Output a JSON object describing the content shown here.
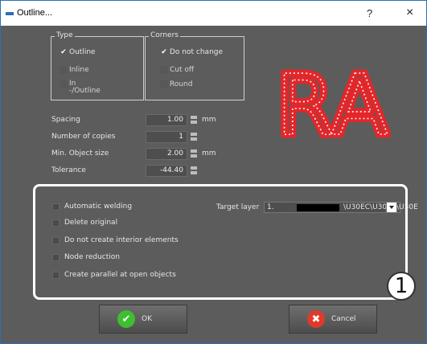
{
  "window": {
    "title": "Outline...",
    "help": "?",
    "close": "×"
  },
  "type_group": {
    "legend": "Type",
    "options": [
      {
        "label": "Outline",
        "checked": true
      },
      {
        "label": "Inline",
        "checked": false
      },
      {
        "label_line1": "In",
        "label_line2": "-/Outline",
        "checked": false
      }
    ]
  },
  "corners_group": {
    "legend": "Corners",
    "options": [
      {
        "label": "Do not change",
        "checked": true
      },
      {
        "label": "Cut off",
        "checked": false
      },
      {
        "label": "Round",
        "checked": false
      }
    ]
  },
  "params": {
    "spacing": {
      "label": "Spacing",
      "value": "1.00",
      "unit": "mm"
    },
    "copies": {
      "label": "Number of copies",
      "value": "1"
    },
    "min_size": {
      "label": "Min. Object size",
      "value": "2.00",
      "unit": "mm"
    },
    "tolerance": {
      "label": "Tolerance",
      "value": "-44.40"
    }
  },
  "preview": {
    "text": "RA"
  },
  "options": {
    "automatic_welding": "Automatic welding",
    "delete_original": "Delete original",
    "no_interior": "Do not create interior elements",
    "node_reduction": "Node reduction",
    "parallel_open": "Create parallel at open objects"
  },
  "target_layer": {
    "label": "Target layer",
    "number": "1.",
    "name": "\\U30EC\\U30A4\\U30E"
  },
  "callout": "1",
  "buttons": {
    "ok": "OK",
    "cancel": "Cancel"
  },
  "colors": {
    "ok": "#3fbf2f",
    "cancel": "#e03a2a",
    "preview_red": "#e3262a",
    "preview_white": "#f2f2f2"
  }
}
